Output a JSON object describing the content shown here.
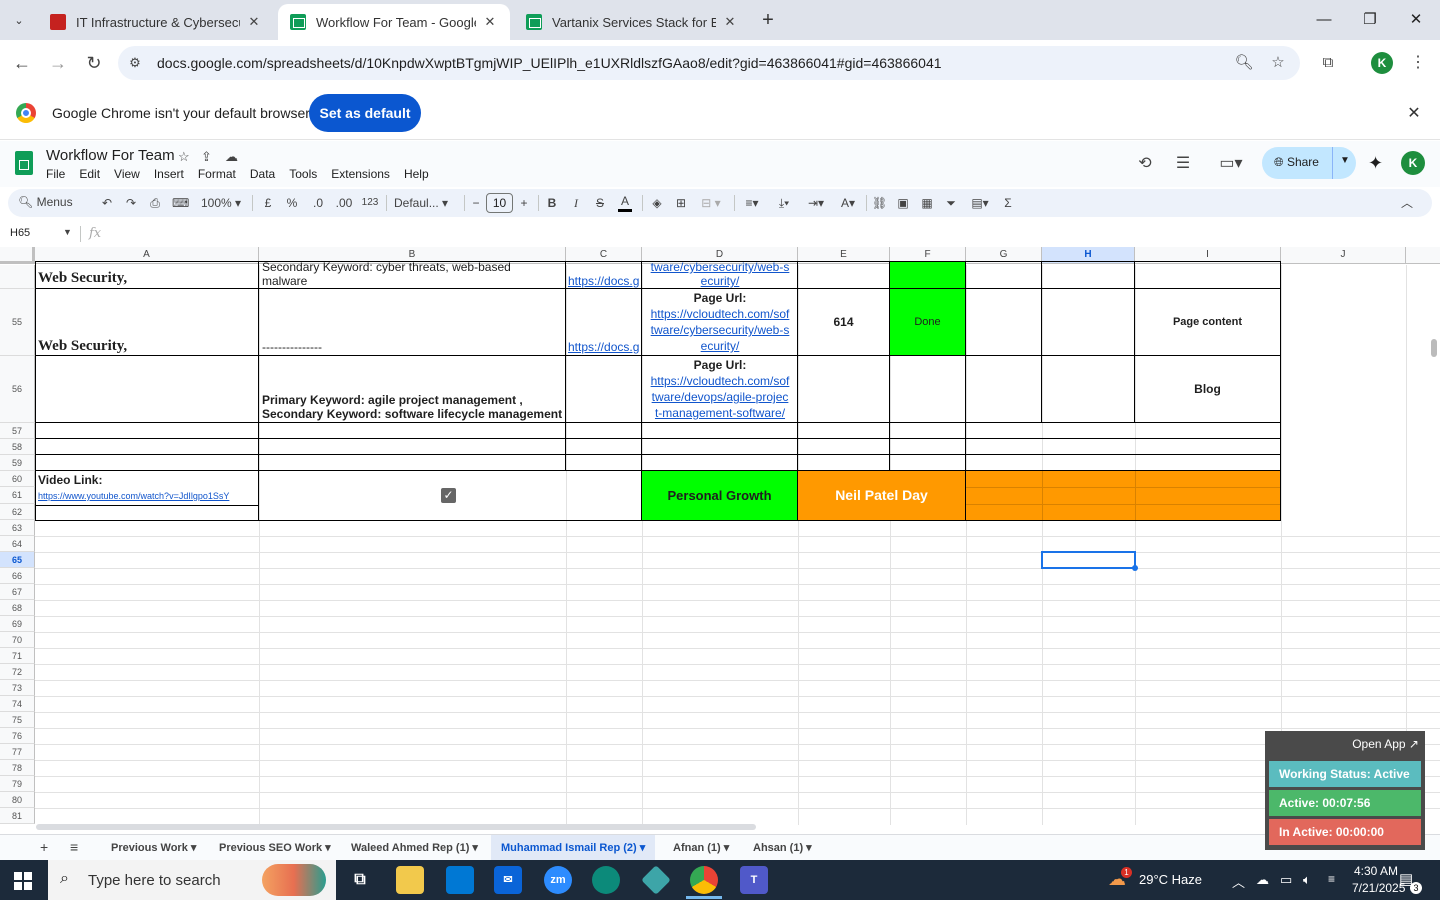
{
  "browser": {
    "tabs": [
      {
        "title": "IT Infrastructure & Cybersecurit",
        "active": false
      },
      {
        "title": "Workflow For Team - Google Sh",
        "active": true
      },
      {
        "title": "Vartanix Services Stack for Blog",
        "active": false
      }
    ],
    "url": "docs.google.com/spreadsheets/d/10KnpdwXwptBTgmjWIP_UElIPlh_e1UXRldlszfGAao8/edit?gid=463866041#gid=463866041",
    "profile_initial": "K"
  },
  "infobar": {
    "message": "Google Chrome isn't your default browser",
    "button": "Set as default"
  },
  "doc": {
    "title": "Workflow For Team",
    "menus": [
      "File",
      "Edit",
      "View",
      "Insert",
      "Format",
      "Data",
      "Tools",
      "Extensions",
      "Help"
    ],
    "share_label": "Share",
    "avatar_initial": "K"
  },
  "toolbar": {
    "menus_label": "Menus",
    "zoom": "100%",
    "currency": "£",
    "percent": "%",
    "dec_less": ".0",
    "dec_more": ".00",
    "number_format": "123",
    "font": "Defaul...",
    "font_size": "10",
    "bold": "B",
    "italic": "I",
    "strike": "S",
    "text_color": "A",
    "sum": "Σ"
  },
  "formula": {
    "name_box": "H65",
    "fx": "fx"
  },
  "columns": [
    "A",
    "B",
    "C",
    "D",
    "E",
    "F",
    "G",
    "H",
    "I",
    "J"
  ],
  "selected_column": "H",
  "rows": [
    "55",
    "56",
    "57",
    "58",
    "59",
    "60",
    "61",
    "62",
    "63",
    "64",
    "65",
    "66",
    "67",
    "68",
    "69",
    "70",
    "71",
    "72",
    "73",
    "74",
    "75",
    "76",
    "77",
    "78",
    "79",
    "80",
    "81"
  ],
  "selected_row": "65",
  "cells": {
    "r54": {
      "a": "Web Security,",
      "b_line1": "Secondary Keyword: cyber threats, web-based",
      "b_line2": "malware",
      "c": "https://docs.g",
      "d_line1": "tware/cybersecurity/web-s",
      "d_line2": "ecurity/"
    },
    "r55": {
      "a": "Web Security,",
      "b": "---------------",
      "c": "https://docs.g",
      "d_label": "Page Url:",
      "d_link": [
        "https://vcloudtech.com/sof",
        "tware/cybersecurity/web-s",
        "ecurity/"
      ],
      "e": "614",
      "f": "Done",
      "i": "Page content"
    },
    "r56": {
      "b_line1": "Primary Keyword:  agile project management ,",
      "b_line2": "Secondary Keyword:  software lifecycle management",
      "d_label": "Page Url:",
      "d_link": [
        "https://vcloudtech.com/sof",
        "tware/devops/agile-projec",
        "t-management-software/"
      ],
      "i": "Blog"
    },
    "r60": {
      "video_label": "Video Link:",
      "video_url": "https://www.youtube.com/watch?v=JdIlgpo1SsY",
      "checkbox_checked": true,
      "personal_growth": "Personal Growth",
      "neil_patel": "Neil Patel Day"
    }
  },
  "sheet_tabs": [
    {
      "label": "Previous Work",
      "active": false
    },
    {
      "label": "Previous SEO Work",
      "active": false
    },
    {
      "label": "Waleed Ahmed Rep (1)",
      "active": false
    },
    {
      "label": "Muhammad Ismail Rep (2)",
      "active": true
    },
    {
      "label": "Afnan (1)",
      "active": false
    },
    {
      "label": "Ahsan (1)",
      "active": false
    }
  ],
  "tracker": {
    "open_app": "Open App ↗",
    "status": "Working Status: Active",
    "active": "Active: 00:07:56",
    "inactive": "In Active: 00:00:00",
    "colors": {
      "status": "#5bbcbf",
      "active": "#4cb86a",
      "inactive": "#e2685c"
    }
  },
  "taskbar": {
    "search_placeholder": "Type here to search",
    "weather": "29°C  Haze",
    "time": "4:30 AM",
    "date": "7/21/2025",
    "notifications": "3",
    "weather_badge": "1"
  },
  "colors": {
    "green_cell": "#00ff00",
    "orange_cell": "#ff9900",
    "link": "#1155cc",
    "accent": "#0b57d0"
  }
}
